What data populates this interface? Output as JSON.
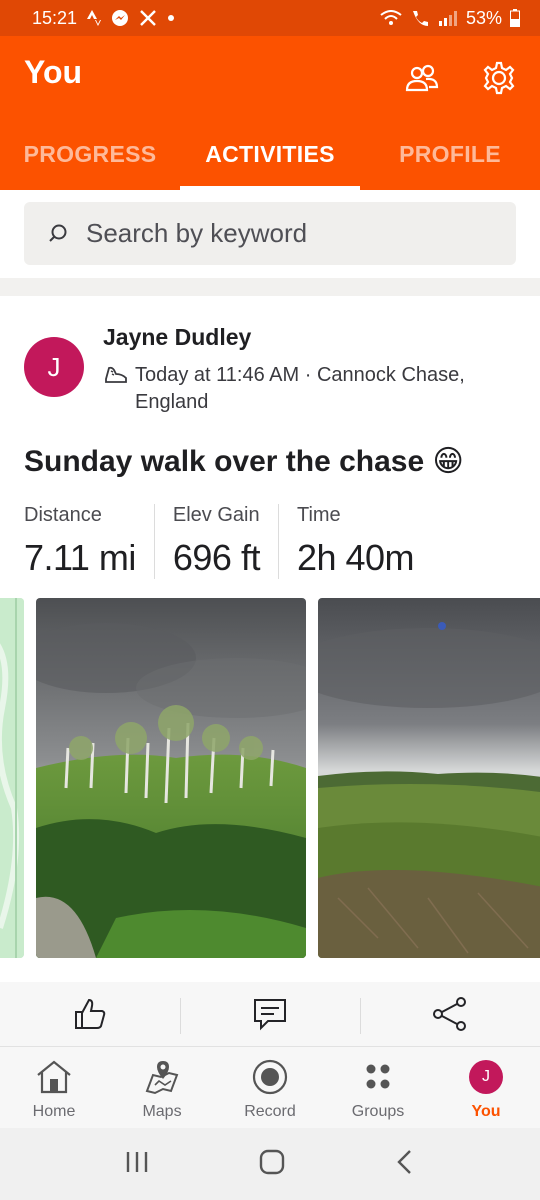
{
  "status_bar": {
    "time": "15:21",
    "battery": "53%"
  },
  "header": {
    "title": "You"
  },
  "tabs": [
    {
      "label": "PROGRESS",
      "active": false
    },
    {
      "label": "ACTIVITIES",
      "active": true
    },
    {
      "label": "PROFILE",
      "active": false
    }
  ],
  "search": {
    "placeholder": "Search by keyword"
  },
  "activity": {
    "avatar_initial": "J",
    "athlete": "Jayne Dudley",
    "meta_line1": "Today at 11:46 AM · Cannock Chase,",
    "meta_line2": "England",
    "title": "Sunday walk over the chase 😁",
    "stats": [
      {
        "label": "Distance",
        "value": "7.11 mi"
      },
      {
        "label": "Elev Gain",
        "value": "696 ft"
      },
      {
        "label": "Time",
        "value": "2h 40m"
      }
    ]
  },
  "bottom_nav": [
    {
      "label": "Home",
      "icon": "home-icon"
    },
    {
      "label": "Maps",
      "icon": "maps-icon"
    },
    {
      "label": "Record",
      "icon": "record-icon"
    },
    {
      "label": "Groups",
      "icon": "groups-icon"
    },
    {
      "label": "You",
      "icon": "avatar",
      "active": true
    }
  ],
  "colors": {
    "brand": "#fc5200",
    "status_bar": "#e04805",
    "avatar": "#c2185b"
  }
}
